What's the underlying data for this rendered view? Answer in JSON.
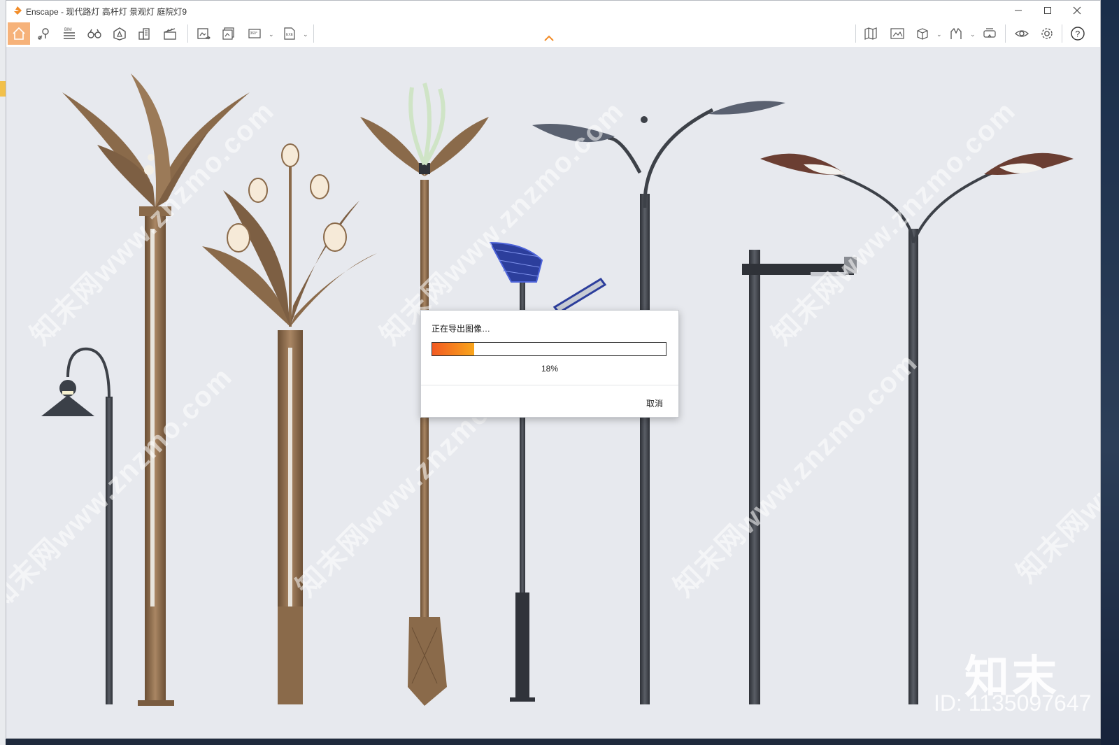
{
  "window": {
    "title": "Enscape - 现代路灯 高杆灯 景观灯 庭院灯9",
    "minimize_icon": "minimize-icon",
    "maximize_icon": "maximize-icon",
    "close_icon": "close-icon"
  },
  "toolbar": {
    "left_tools": [
      "home-icon",
      "location-pin-icon",
      "bim-icon",
      "binoculars-icon",
      "asset-icon",
      "buildings-icon",
      "clapperboard-icon"
    ],
    "export_tools": [
      "screenshot-export-icon",
      "batch-export-icon",
      "panorama-360-icon",
      "exe-export-icon"
    ],
    "right_tools": [
      "map-icon",
      "image-view-icon",
      "cube-view-icon",
      "path-icon",
      "vr-headset-icon",
      "eye-icon",
      "settings-icon",
      "help-icon"
    ],
    "bim_label": "BIM",
    "pano_label": "360°",
    "exe_label": "EXE",
    "help_label": "?"
  },
  "dialog": {
    "title": "正在导出图像…",
    "progress": 0.18,
    "percent_text": "18%",
    "cancel_label": "取消",
    "progress_colors": [
      "#f25a22",
      "#f8a51b"
    ]
  },
  "watermark": {
    "repeat_text": "知末网www.znzmo.com",
    "brand": "知末",
    "id_text": "ID: 1135097647"
  },
  "colors": {
    "accent": "#f28c28",
    "home_active": "#f6b27a",
    "bronze": "#8a6a4a",
    "pole_dark": "#3d4148"
  }
}
